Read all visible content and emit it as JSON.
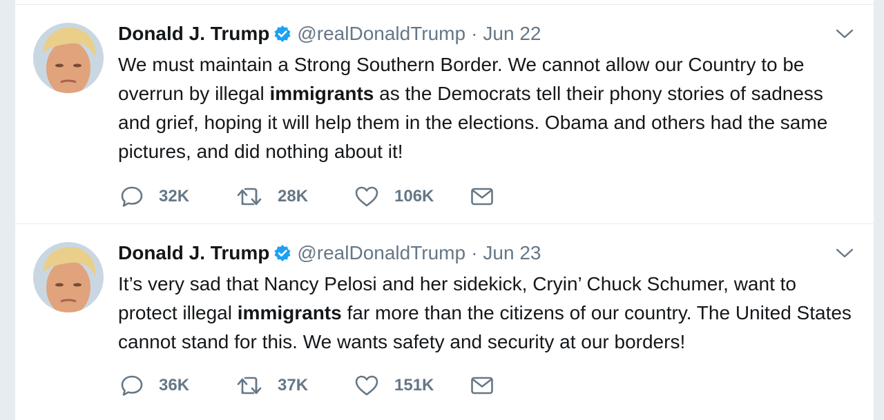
{
  "colors": {
    "verified_badge": "#1da1f2",
    "secondary_text": "#657786",
    "primary_text": "#14171a",
    "background": "#e6ecf0"
  },
  "tweets": [
    {
      "fullname": "Donald J. Trump",
      "verified_icon": "verified-badge-icon",
      "username": "@realDonaldTrump",
      "separator": "·",
      "timestamp": "Jun 22",
      "text_parts": [
        "We must maintain a Strong Southern Border. We cannot allow our Country to be overrun by illegal ",
        "immigrants",
        " as the Democrats tell their phony stories of sadness and grief, hoping it will help them in the elections. Obama and others had the same pictures, and did nothing about it!"
      ],
      "replies": "32K",
      "retweets": "28K",
      "likes": "106K"
    },
    {
      "fullname": "Donald J. Trump",
      "verified_icon": "verified-badge-icon",
      "username": "@realDonaldTrump",
      "separator": "·",
      "timestamp": "Jun 23",
      "text_parts": [
        "It’s very sad that Nancy Pelosi and her sidekick, Cryin’ Chuck Schumer, want to protect illegal ",
        "immigrants",
        " far more than the citizens of our country. The United States cannot stand for this. We wants safety and security at our borders!"
      ],
      "replies": "36K",
      "retweets": "37K",
      "likes": "151K"
    }
  ]
}
